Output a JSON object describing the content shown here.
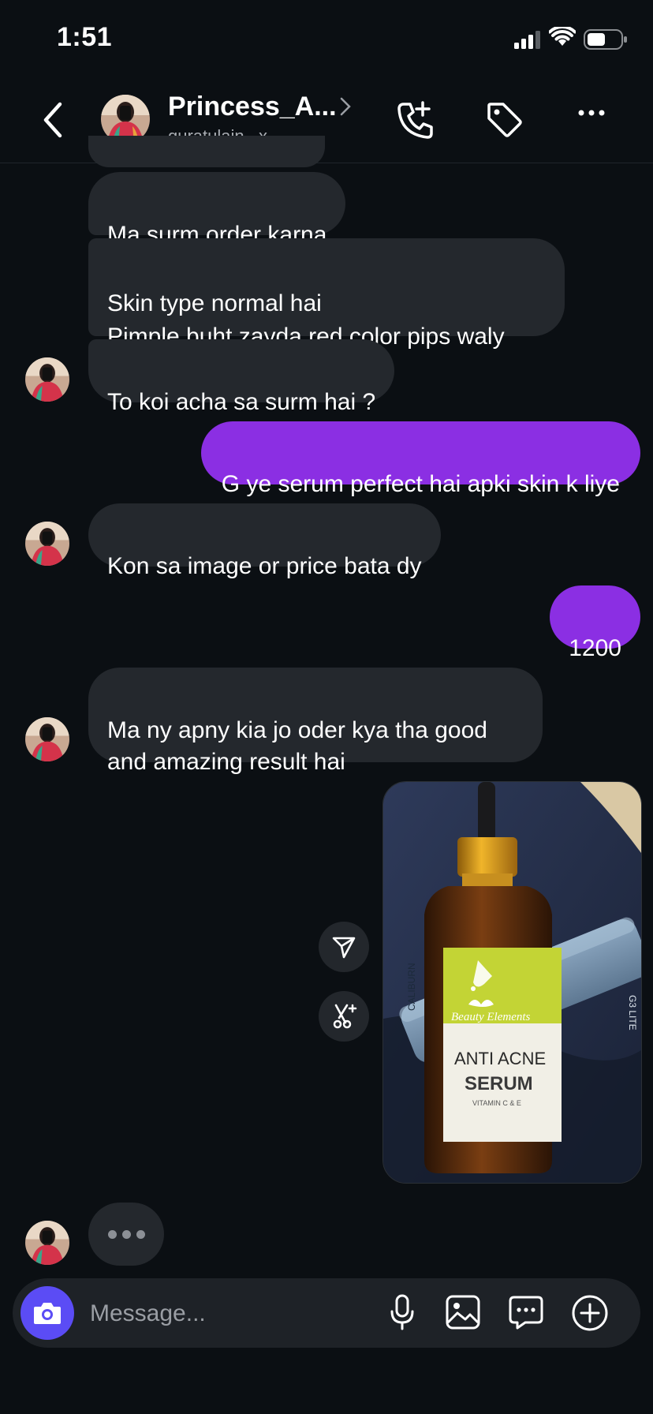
{
  "status_bar": {
    "time": "1:51"
  },
  "header": {
    "contact_name": "Princess_A...",
    "username": "quratulain._x"
  },
  "messages": [
    {
      "id": "m1",
      "sender": "contact",
      "text": "Ma surm order karna"
    },
    {
      "id": "m2",
      "sender": "contact",
      "text": "Skin type normal hai\nPimple buht zayda red color  pips waly"
    },
    {
      "id": "m3",
      "sender": "contact",
      "text": "To koi acha sa surm hai ?"
    },
    {
      "id": "m4",
      "sender": "me",
      "text": "G ye serum perfect hai apki skin k liye"
    },
    {
      "id": "m5",
      "sender": "contact",
      "text": "Kon sa image or price bata dy"
    },
    {
      "id": "m6",
      "sender": "me",
      "text": "1200"
    },
    {
      "id": "m7",
      "sender": "contact",
      "text": "Ma ny apny kia jo oder kya tha good\nand amazing result hai"
    }
  ],
  "photo": {
    "brand": "Beauty Elements",
    "line1": "ANTI ACNE",
    "line2": "SERUM",
    "line3": "VITAMIN C & E",
    "side_text_1": "CALIBURN",
    "side_text_2": "G3 LITE"
  },
  "composer": {
    "placeholder": "Message..."
  },
  "colors": {
    "background": "#0b0f13",
    "incoming_bubble": "#24282d",
    "outgoing_bubble": "#8b2fe3",
    "camera_button": "#5b4cf5"
  },
  "icons": [
    "back-arrow-icon",
    "chevron-right-icon",
    "add-call-icon",
    "tag-icon",
    "more-icon",
    "share-icon",
    "ai-edit-icon",
    "camera-icon",
    "microphone-icon",
    "gallery-icon",
    "sticker-icon",
    "plus-icon"
  ]
}
